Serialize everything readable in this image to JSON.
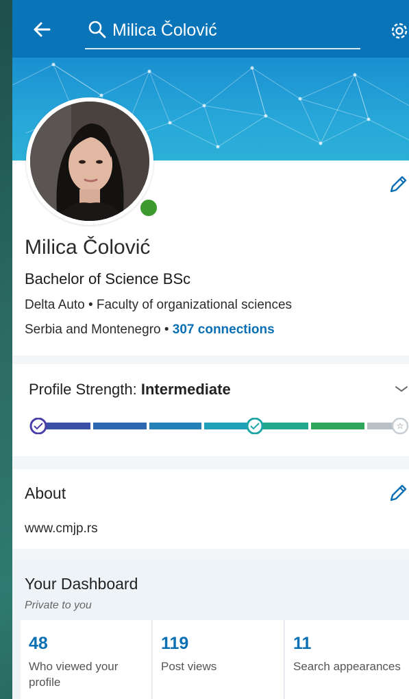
{
  "topbar": {
    "search_text": "Milica Čolović"
  },
  "profile": {
    "name": "Milica Čolović",
    "headline": "Bachelor of Science BSc",
    "company_line": "Delta Auto • Faculty of organizational sciences",
    "location": "Serbia and Montenegro • ",
    "connections": "307 connections"
  },
  "strength": {
    "label": "Profile Strength: ",
    "level": "Intermediate",
    "progress_steps_completed": 2,
    "progress_steps_total": 3
  },
  "about": {
    "title": "About",
    "text": "www.cmjp.rs"
  },
  "dashboard": {
    "title": "Your Dashboard",
    "subtitle": "Private to you",
    "stats": [
      {
        "value": "48",
        "label": "Who viewed your profile"
      },
      {
        "value": "119",
        "label": "Post views"
      },
      {
        "value": "11",
        "label": "Search appearances"
      }
    ]
  },
  "colors": {
    "topbar": "#0a74b8",
    "link": "#0a6fb3",
    "online": "#3c9a2e"
  },
  "icons": [
    "back-arrow-icon",
    "search-icon",
    "gear-icon",
    "pencil-icon",
    "chevron-down-icon",
    "check-icon",
    "star-icon"
  ]
}
